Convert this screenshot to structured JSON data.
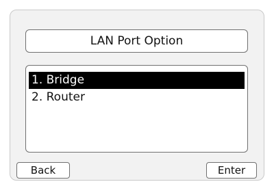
{
  "title": "LAN Port Option",
  "menu": {
    "items": [
      {
        "label": "1. Bridge",
        "selected": true
      },
      {
        "label": "2. Router",
        "selected": false
      }
    ]
  },
  "softkeys": {
    "left": "Back",
    "right": "Enter"
  },
  "colors": {
    "selection_bg": "#000000",
    "selection_fg": "#ffffff",
    "screen_bg": "#f2f2f2"
  }
}
